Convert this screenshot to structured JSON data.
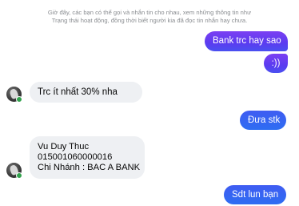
{
  "notice": {
    "line1": "Giờ đây, các bạn có thể gọi và nhắn tin cho nhau, xem những thông tin như",
    "line2": "Trạng thái hoạt động, đồng thời biết người kia đã đọc tin nhắn hay chưa."
  },
  "messages": {
    "m1": "Bank trc hay sao",
    "m2": ":))",
    "m3": "Trc ít nhất 30% nha",
    "m4": "Đưa stk",
    "m5": {
      "line1": "Vu Duy Thuc",
      "line2": "015001060000016",
      "line3": "Chi Nhánh : BAC A BANK"
    },
    "m6": "Sdt lun bạn"
  },
  "colors": {
    "outgoing": "#5b3cf0",
    "outgoing_blue": "#2e6df2",
    "incoming": "#eef0f3",
    "online": "#31a24c"
  }
}
